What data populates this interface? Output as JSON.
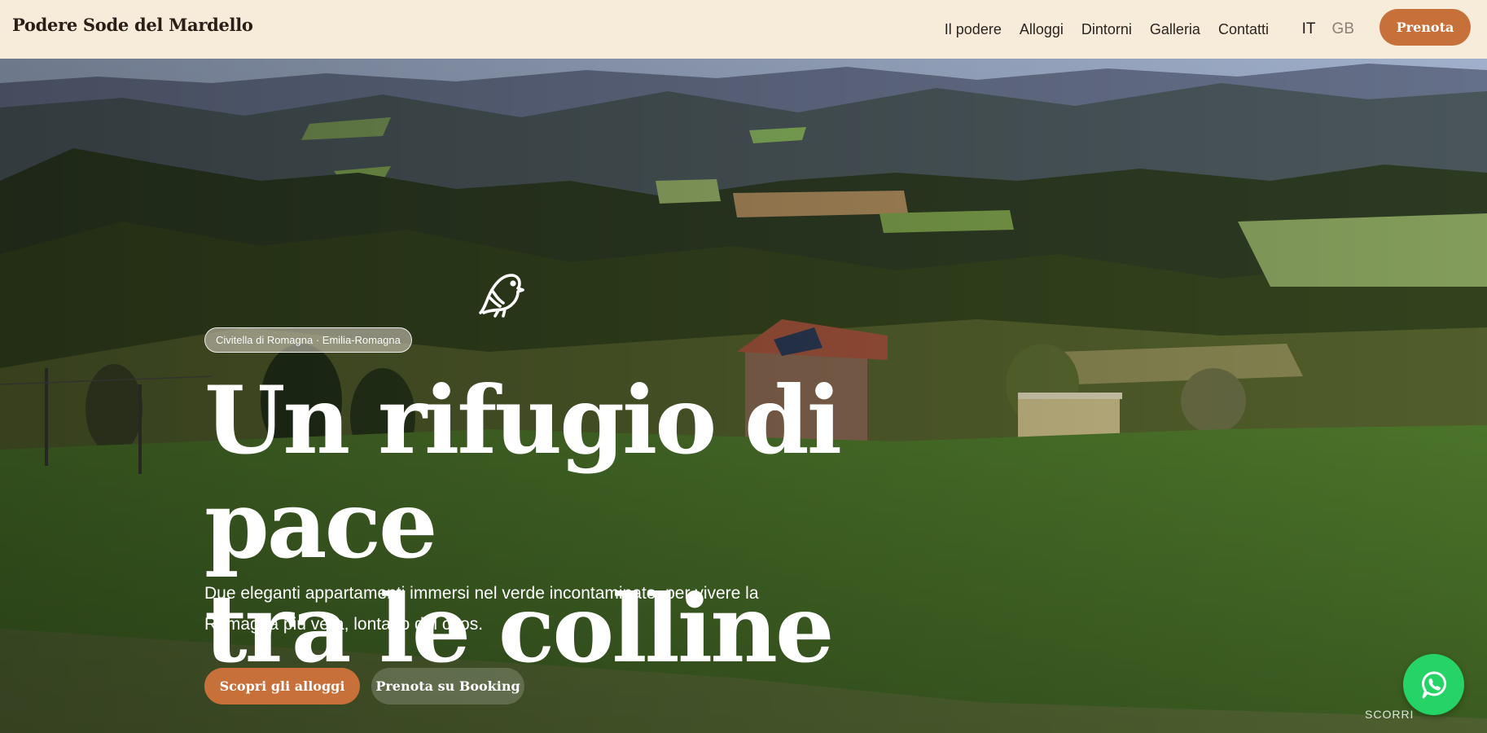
{
  "header": {
    "brand": "Podere Sode del Mardello",
    "nav": [
      "Il podere",
      "Alloggi",
      "Dintorni",
      "Galleria",
      "Contatti"
    ],
    "languages": [
      "IT",
      "GB"
    ],
    "active_language": "IT",
    "book_label": "Prenota"
  },
  "hero": {
    "location": "Civitella di Romagna · Emilia-Romagna",
    "headline_line1": "Un rifugio di pace",
    "headline_line2": "tra le colline",
    "subtitle_line1": "Due eleganti appartamenti immersi nel verde incontaminato, per vivere la",
    "subtitle_line2": "Romagna più vera, lontano dal caos.",
    "cta_primary": "Scopri gli alloggi",
    "cta_secondary": "Prenota su Booking",
    "scroll_label": "SCORRI"
  },
  "icons": {
    "bird": "bird-icon",
    "whatsapp": "whatsapp-icon"
  },
  "colors": {
    "header_bg": "#f7ebda",
    "accent": "#c8703a",
    "whatsapp": "#25d366"
  }
}
